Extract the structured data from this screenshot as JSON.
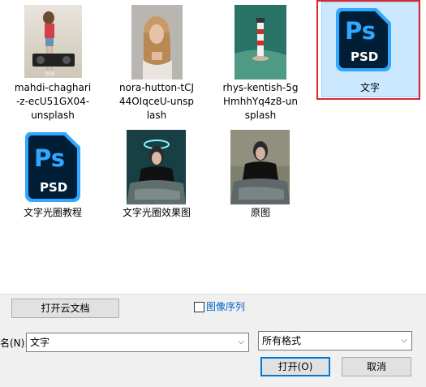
{
  "files": [
    {
      "name": "mahdi-chaghari-z-ecU51GX04-unsplash",
      "lines": [
        "mahdi-chaghari",
        "-z-ecU51GX04-",
        "unsplash"
      ]
    },
    {
      "name": "nora-hutton-tCJ44OIqceU-unsplash",
      "lines": [
        "nora-hutton-tCJ",
        "44OIqceU-unsp",
        "lash"
      ]
    },
    {
      "name": "rhys-kentish-5gHmhhYq4z8-unsplash",
      "lines": [
        "rhys-kentish-5g",
        "HmhhYq4z8-un",
        "splash"
      ]
    },
    {
      "name": "文字",
      "lines": [
        "文字"
      ]
    },
    {
      "name": "文字光圈教程",
      "lines": [
        "文字光圈教程"
      ]
    },
    {
      "name": "文字光圈效果图",
      "lines": [
        "文字光圈效果图"
      ]
    },
    {
      "name": "原图",
      "lines": [
        "原图"
      ]
    }
  ],
  "psd_icon": {
    "top": "Ps",
    "bottom": "PSD",
    "bg": "#001e36",
    "accent": "#31a8ff"
  },
  "colors": {
    "selection": "#cce8ff",
    "highlight_box": "#e0262b"
  },
  "bottom": {
    "open_cloud_label": "打开云文档",
    "image_sequence_label": "图像序列",
    "filename_label": "名(N):",
    "filename_value": "文字",
    "format_value": "所有格式",
    "open_label": "打开(O)",
    "cancel_label": "取消"
  }
}
